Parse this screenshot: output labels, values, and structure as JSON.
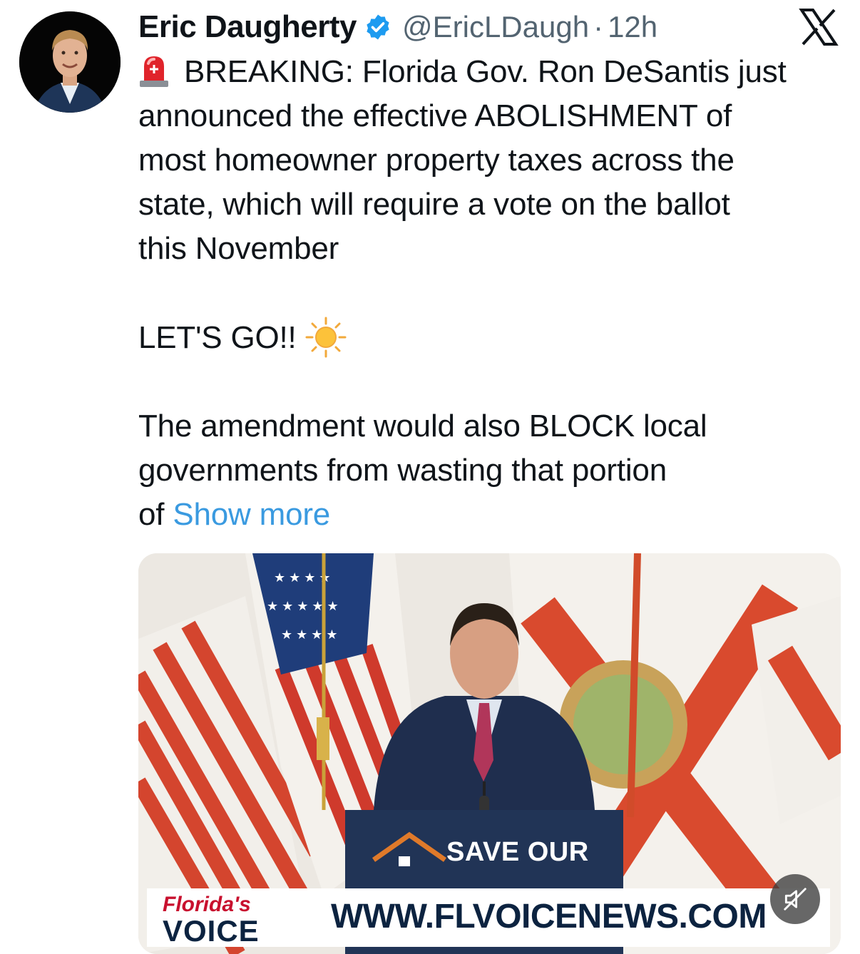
{
  "tweet": {
    "author_name": "Eric Daugherty",
    "handle": "@EricLDaugh",
    "separator": "·",
    "time": "12h",
    "line1": "BREAKING: Florida Gov. Ron DeSantis just",
    "line2": "announced the effective ABOLISHMENT of",
    "line3": "most homeowner property taxes across the",
    "line4": "state, which will require a vote on the ballot",
    "line5": "this November",
    "cheer": "LET'S GO!!",
    "line6": "The amendment would also BLOCK local",
    "line7": "governments from wasting that portion",
    "line8_prefix": "of",
    "show_more": "Show more"
  },
  "media": {
    "podium_text": "SAVE OUR",
    "logo_top": "Florida's",
    "logo_bottom": "VOICE",
    "url_text": "WWW.FLVOICENEWS.COM"
  },
  "colors": {
    "link": "#3a9ae0",
    "verified": "#1d9bf0",
    "muted_text": "#536471",
    "brand_red": "#c8102e",
    "brand_navy": "#0c2340"
  },
  "icons": [
    "verified-badge-icon",
    "x-logo-icon",
    "siren-emoji-icon",
    "sun-emoji-icon",
    "mute-icon"
  ]
}
